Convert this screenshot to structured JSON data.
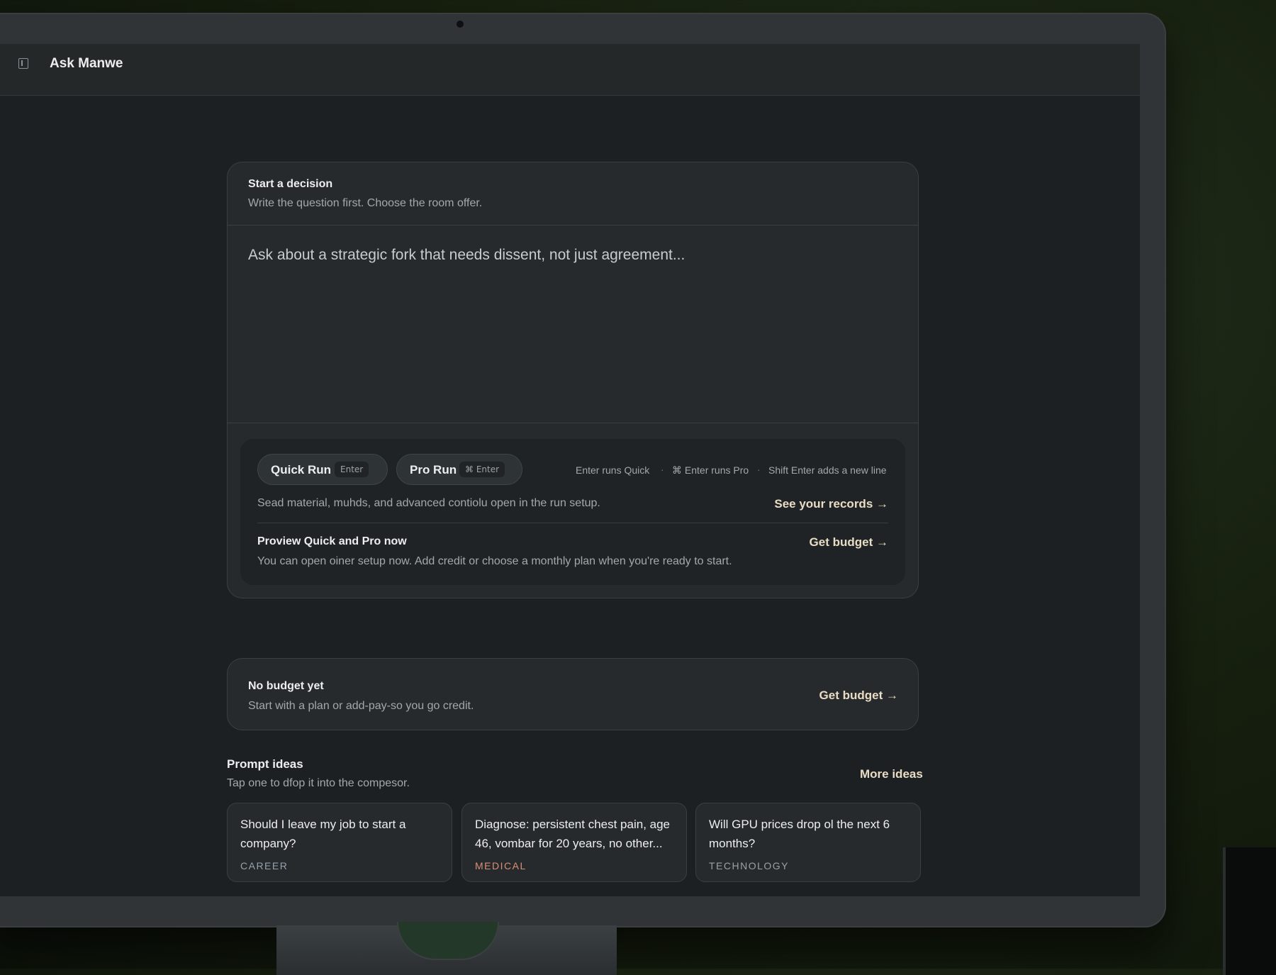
{
  "colors": {
    "accent_link": "#e9dcc4",
    "tag_career": "#97a2ad",
    "tag_medical": "#d98f77",
    "tag_technology": "#9aa1a6"
  },
  "header": {
    "sidebar_icon": "sidebar-toggle-icon",
    "title": "Ask Manwe"
  },
  "composer": {
    "title": "Start a decision",
    "subtitle": "Write the question first. Choose the room offer.",
    "placeholder": "Ask about a strategic fork that needs dissent, not just agreement...",
    "quick_run": {
      "label": "Quick Run",
      "shortcut": "Enter"
    },
    "pro_run": {
      "label": "Pro Run",
      "shortcut": "⌘ Enter"
    },
    "hints": [
      "Enter runs Quick",
      "⌘ Enter runs Pro",
      "Shift Enter adds a new line"
    ],
    "hint_separator": "·",
    "setup_note": "Sead material, muhds, and advanced contiolu open in the run setup.",
    "records_link": "See your records →",
    "preview_title": "Proview Quick and Pro now",
    "preview_text": "You can open oiner setup now. Add credit or choose a monthly plan when you're ready to start.",
    "preview_budget_link": "Get budget →"
  },
  "budget": {
    "title": "No budget yet",
    "subtitle": "Start with a plan or add-pay-so you go credit.",
    "link": "Get budget →"
  },
  "ideas": {
    "title": "Prompt ideas",
    "subtitle": "Tap one to dfop it into the compesor.",
    "more_link": "More ideas",
    "items": [
      {
        "text": "Should I leave my job to start a company?",
        "tag": "CAREER"
      },
      {
        "text": "Diagnose: persistent chest pain, age 46, vombar for 20 years, no other...",
        "tag": "MEDICAL"
      },
      {
        "text": "Will GPU prices drop ol the next 6 months?",
        "tag": "TECHNOLOGY"
      }
    ]
  }
}
